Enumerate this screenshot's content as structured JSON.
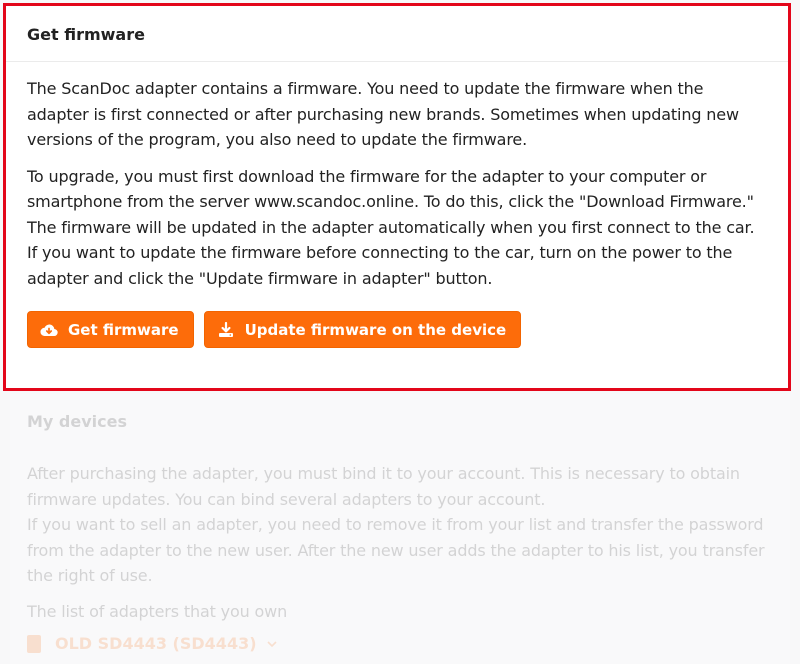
{
  "firmware_card": {
    "title": "Get firmware",
    "paragraph_1": "The ScanDoc adapter contains a firmware. You need to update the firmware when the adapter is first connected or after purchasing new brands. Sometimes when updating new versions of the program, you also need to update the firmware.",
    "paragraph_2": "To upgrade, you must first download the firmware for the adapter to your computer or smartphone from the server www.scandoc.online. To do this, click the \"Download Firmware.\"",
    "paragraph_3": "The firmware will be updated in the adapter automatically when you first connect to the car. If you want to update the firmware before connecting to the car, turn on the power to the adapter and click the \"Update firmware in adapter\" button.",
    "get_firmware_label": "Get firmware",
    "update_firmware_label": "Update firmware on the device",
    "get_firmware_icon": "cloud-download-icon",
    "update_firmware_icon": "download-icon"
  },
  "devices_card": {
    "title": "My devices",
    "paragraph_1": "After purchasing the adapter, you must bind it to your account. This is necessary to obtain firmware updates. You can bind several adapters to your account.",
    "paragraph_2": "If you want to sell an adapter, you need to remove it from your list and transfer the password from the adapter to the new user. After the new user adds the adapter to his list, you transfer the right of use.",
    "list_label": "The list of adapters that you own",
    "device_name": "OLD SD4443 (SD4443)",
    "device_icon": "sd-card-icon"
  },
  "colors": {
    "accent": "#fd6c0a",
    "highlight_border": "#e3061a"
  }
}
